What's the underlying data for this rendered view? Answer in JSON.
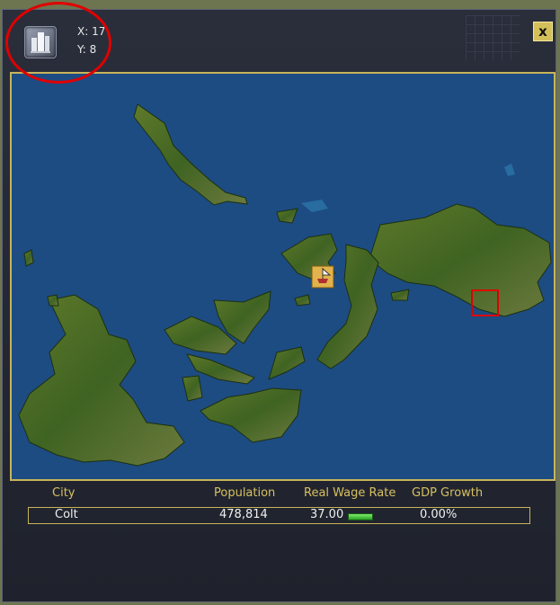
{
  "coords": {
    "x_label": "X: 17",
    "y_label": "Y: 8"
  },
  "icons": {
    "city": "city-buildings-icon",
    "ship": "ship-icon",
    "close": "close-icon"
  },
  "window": {
    "close_label": "x"
  },
  "map": {
    "water_color": "#1d4c82",
    "land_color": "#3a5f20",
    "selection_color": "#e00000",
    "ship_tile_color": "#e1b34d"
  },
  "table": {
    "headers": {
      "city": "City",
      "population": "Population",
      "wage": "Real Wage Rate",
      "gdp": "GDP Growth"
    },
    "rows": [
      {
        "city": "Colt",
        "population": "478,814",
        "wage": "37.00",
        "gdp": "0.00%"
      }
    ]
  },
  "colors": {
    "accent_gold": "#c8b45a",
    "header_text": "#d7c05f",
    "annotation_red": "#e00000"
  }
}
